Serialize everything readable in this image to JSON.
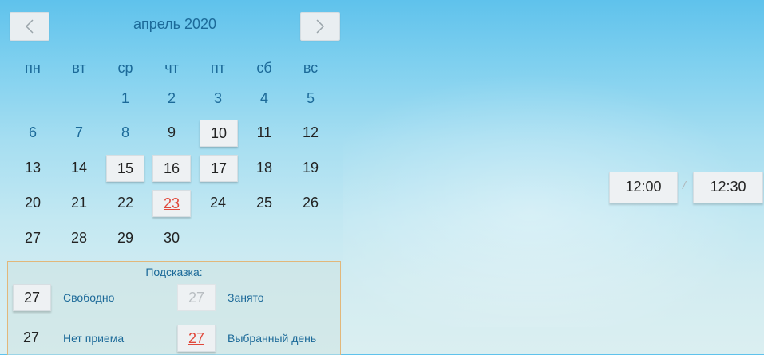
{
  "header": {
    "title": "апрель 2020",
    "prev_icon": "chevron-left-icon",
    "next_icon": "chevron-right-icon"
  },
  "weekdays": [
    "пн",
    "вт",
    "ср",
    "чт",
    "пт",
    "сб",
    "вс"
  ],
  "days": {
    "r1": [
      "1",
      "2",
      "3",
      "4",
      "5"
    ],
    "r2": [
      "6",
      "7",
      "8",
      "9",
      "10",
      "11",
      "12"
    ],
    "r3": [
      "13",
      "14",
      "15",
      "16",
      "17",
      "18",
      "19"
    ],
    "r4": [
      "20",
      "21",
      "22",
      "23",
      "24",
      "25",
      "26"
    ],
    "r5": [
      "27",
      "28",
      "29",
      "30"
    ]
  },
  "legend": {
    "title": "Подсказка:",
    "sample_day": "27",
    "free_label": "Свободно",
    "busy_label": "Занято",
    "no_reception_label": "Нет приема",
    "selected_label": "Выбранный день"
  },
  "time_slots": [
    "12:00",
    "12:30"
  ],
  "slot_separator": "/",
  "colors": {
    "accent": "#1c6a99",
    "selected": "#e0473a",
    "legend_border": "#e2b77a"
  }
}
